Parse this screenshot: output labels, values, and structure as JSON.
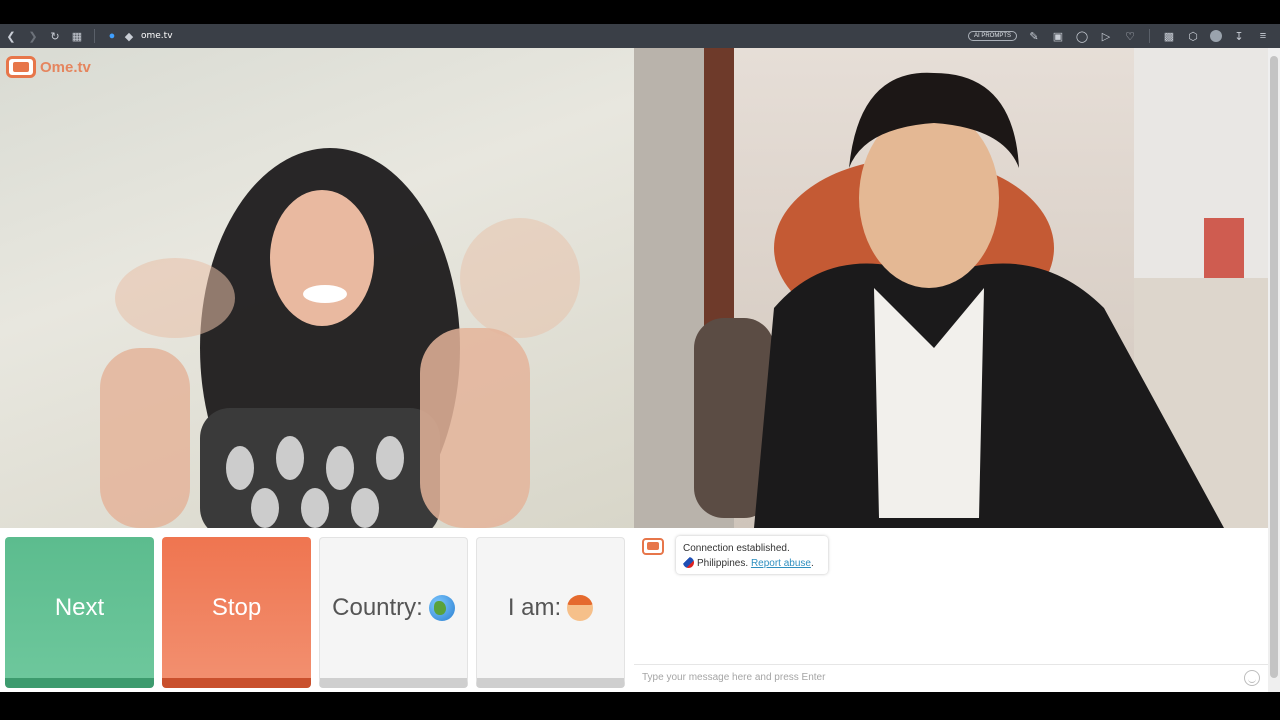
{
  "browser": {
    "url": "ome.tv",
    "ai_prompts_label": "AI PROMPTS"
  },
  "site": {
    "logo_text": "Ome.tv"
  },
  "controls": {
    "next_label": "Next",
    "stop_label": "Stop",
    "country_label": "Country:",
    "iam_label": "I am:"
  },
  "chat": {
    "status_line": "Connection established.",
    "country": "Philippines.",
    "report_link": "Report abuse",
    "report_suffix": ".",
    "input_placeholder": "Type your message here and press Enter"
  },
  "colors": {
    "next": "#5cbc8e",
    "stop": "#ef7550",
    "brand": "#e7764a",
    "link": "#2f8fbf"
  }
}
